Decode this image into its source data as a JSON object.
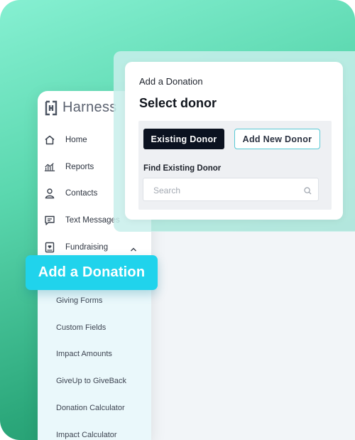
{
  "app": {
    "name": "Harness"
  },
  "sidebar": {
    "items": [
      {
        "label": "Home",
        "icon": "home-icon"
      },
      {
        "label": "Reports",
        "icon": "reports-chart-icon"
      },
      {
        "label": "Contacts",
        "icon": "contact-person-icon"
      },
      {
        "label": "Text Messages",
        "icon": "message-icon"
      },
      {
        "label": "Fundraising",
        "icon": "fundraising-heart-icon",
        "expanded": true
      }
    ],
    "sub_items": [
      "Giving Forms",
      "Custom Fields",
      "Impact Amounts",
      "GiveUp to GiveBack",
      "Donation Calculator",
      "Impact Calculator"
    ]
  },
  "highlight": {
    "label": "Add a Donation"
  },
  "modal": {
    "title": "Add a Donation",
    "heading": "Select donor",
    "existing_donor_label": "Existing Donor",
    "new_donor_label": "Add New Donor",
    "find_label": "Find Existing Donor",
    "search_placeholder": "Search",
    "search_value": ""
  },
  "colors": {
    "accent_cyan": "#20d3ec",
    "primary_dark": "#0b1220",
    "outline_teal": "#57c9d5",
    "bg_green": "#2ba77a"
  }
}
